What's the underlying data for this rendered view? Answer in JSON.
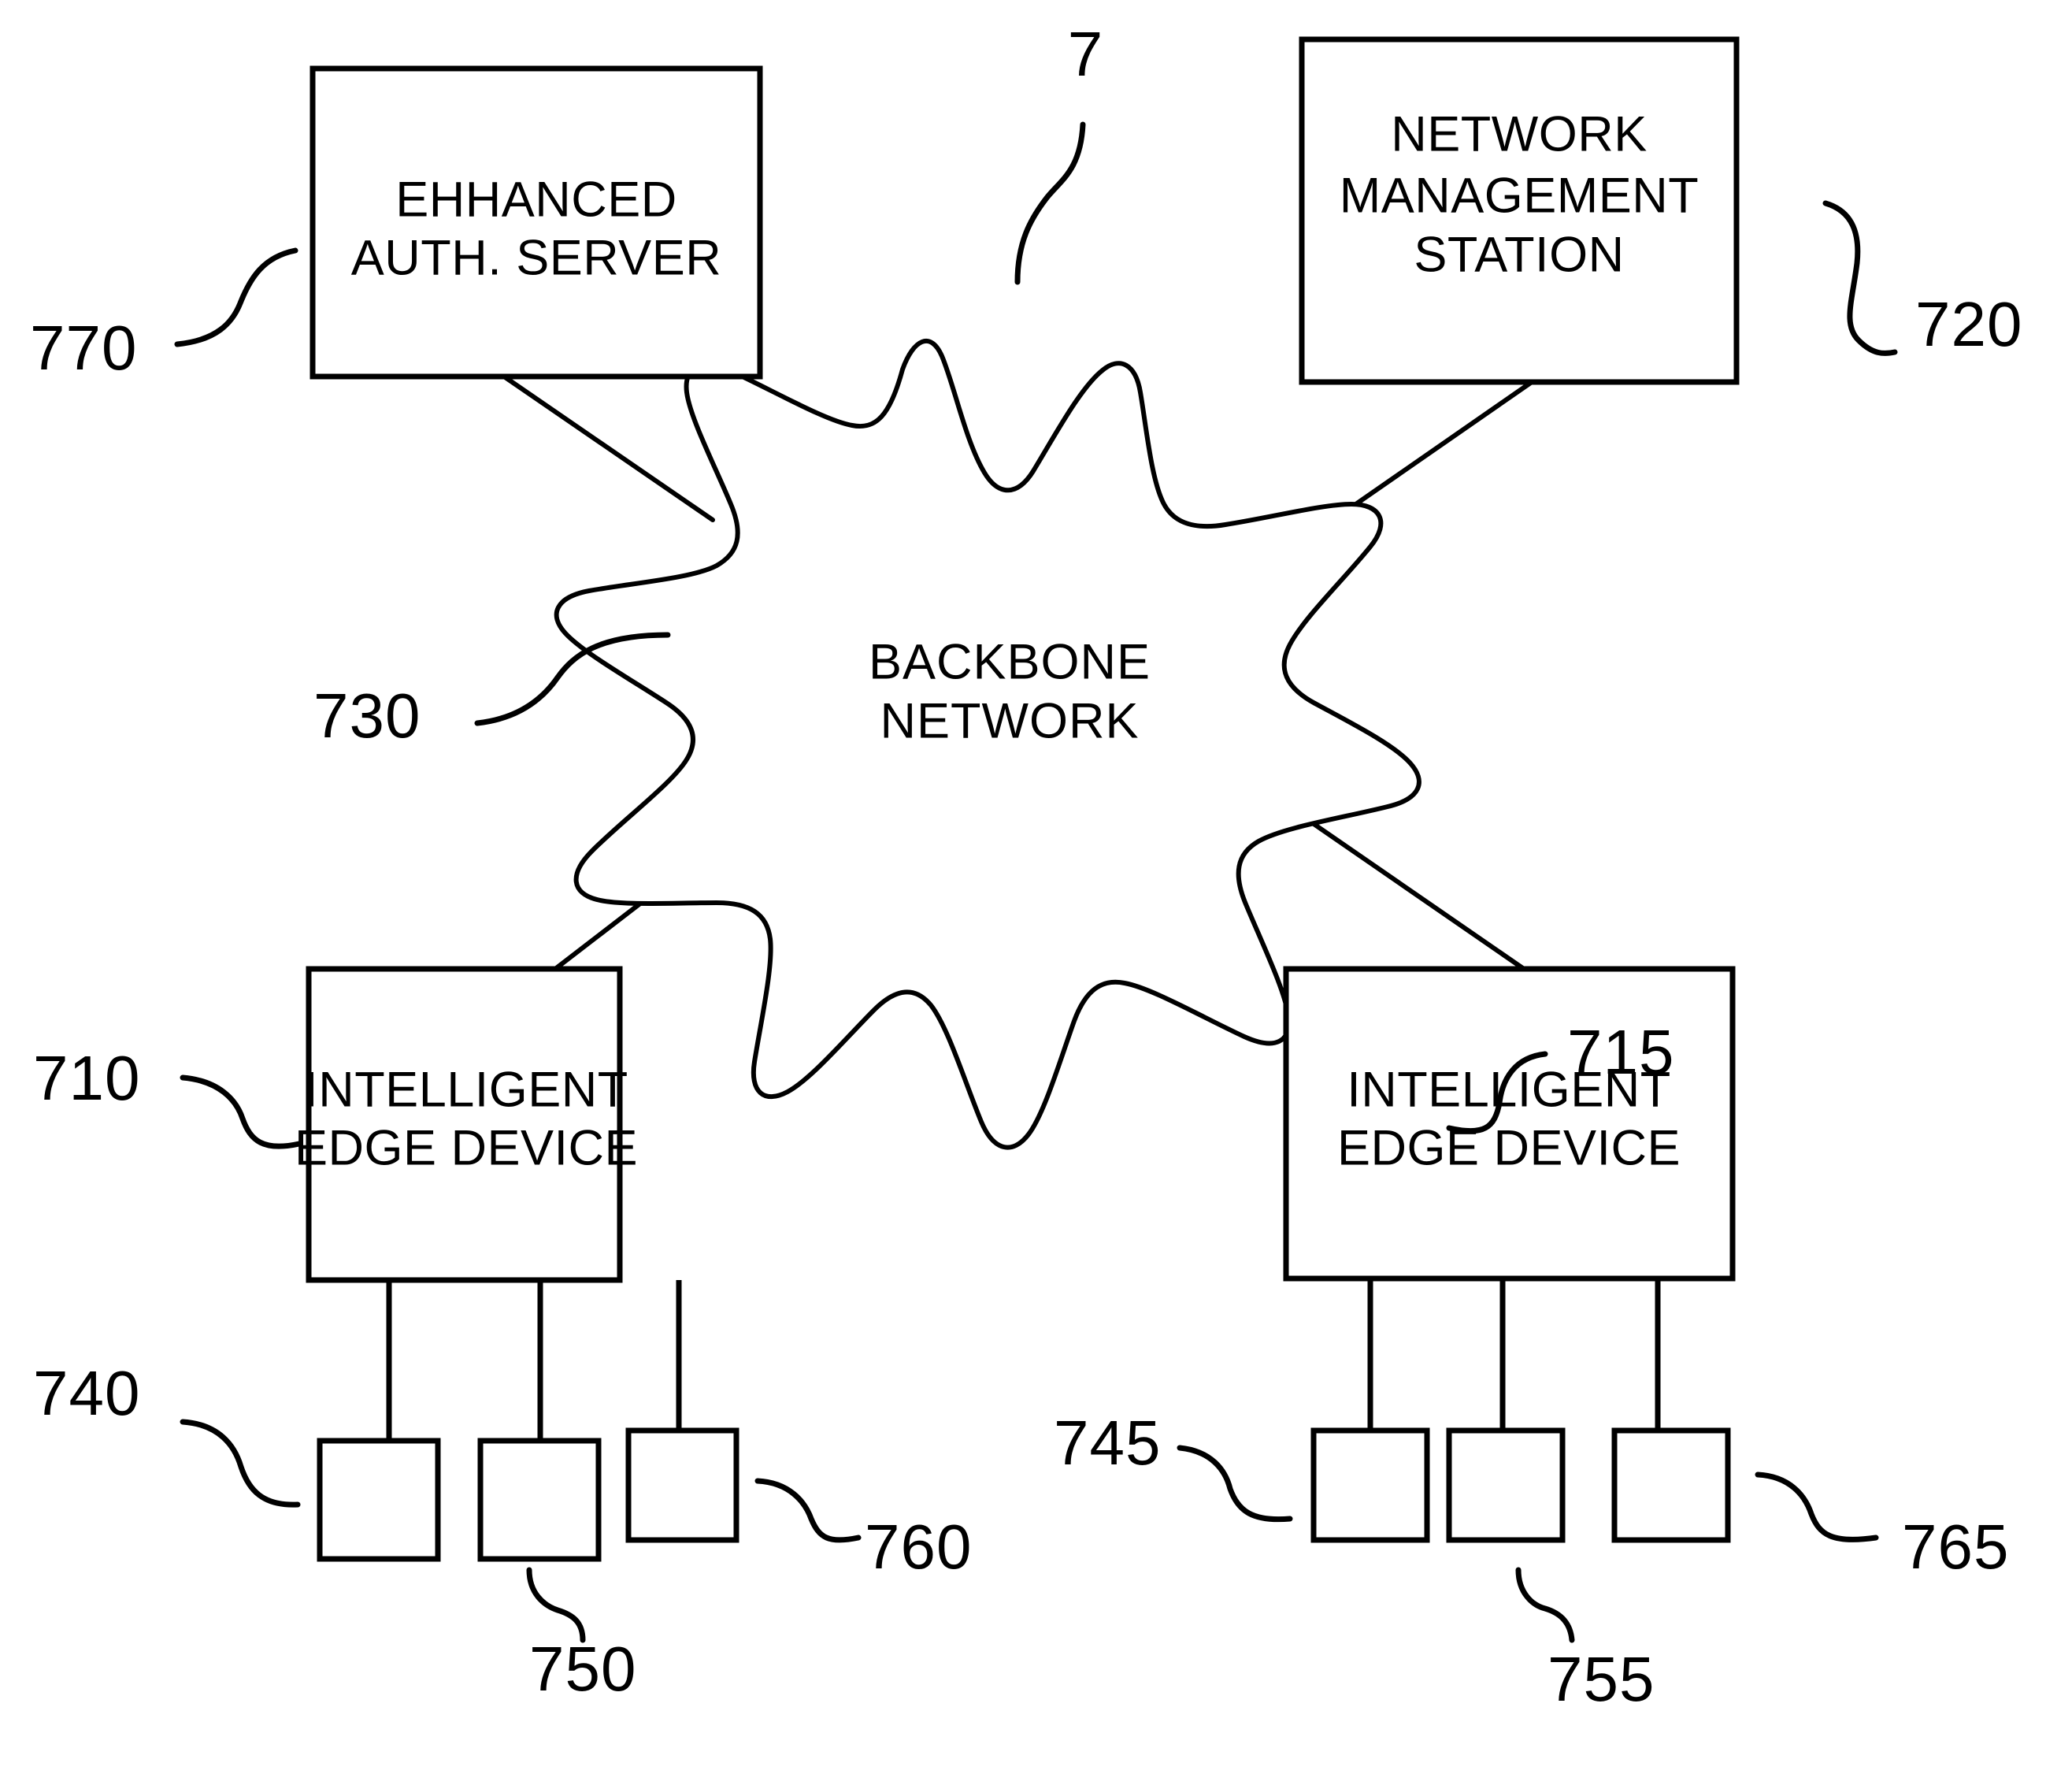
{
  "figure": {
    "number": "7",
    "type": "network-architecture-diagram"
  },
  "nodes": {
    "enhanced_auth_server": {
      "line1": "EHHANCED",
      "line2": "AUTH. SERVER",
      "ref": "770"
    },
    "network_management_station": {
      "line1": "NETWORK",
      "line2": "MANAGEMENT",
      "line3": "STATION",
      "ref": "720"
    },
    "backbone_network": {
      "line1": "BACKBONE",
      "line2": "NETWORK",
      "ref": "730"
    },
    "intelligent_edge_device_left": {
      "line1": "INTELLIGENT",
      "line2": "EDGE DEVICE",
      "ref": "710"
    },
    "intelligent_edge_device_right": {
      "line1": "INTELLIGENT",
      "line2": "EDGE DEVICE",
      "ref": "715"
    }
  },
  "endpoints": {
    "left": [
      {
        "ref": "740"
      },
      {
        "ref": "750"
      },
      {
        "ref": "760"
      }
    ],
    "right": [
      {
        "ref": "745"
      },
      {
        "ref": "755"
      },
      {
        "ref": "765"
      }
    ]
  },
  "colors": {
    "stroke": "#000000",
    "background": "#ffffff"
  }
}
